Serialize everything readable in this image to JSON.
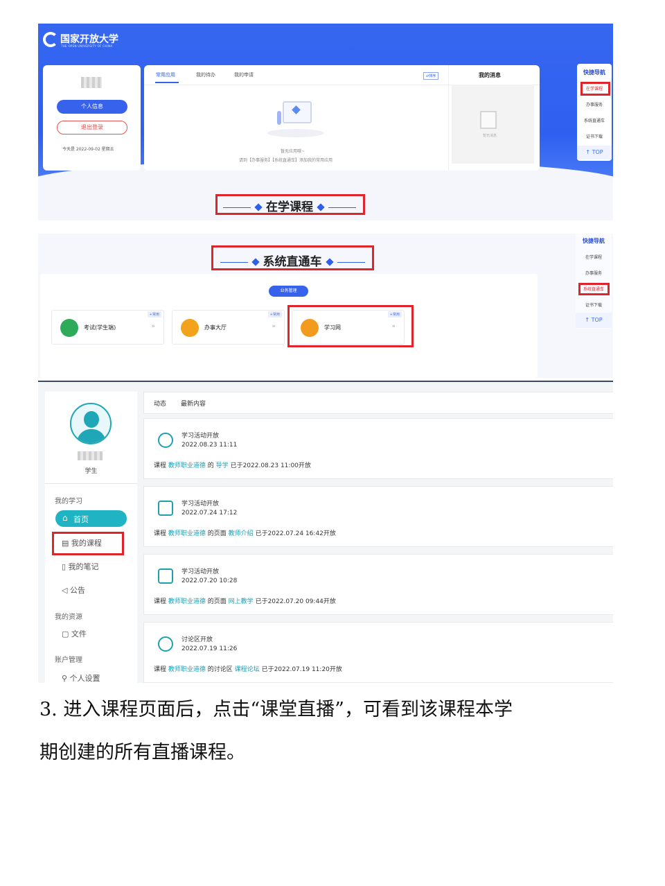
{
  "shot1": {
    "logo_name": "国家开放大学",
    "logo_sub": "THE OPEN UNIVERSITY OF CHINA",
    "user": {
      "info_button": "个人信息",
      "logout_button": "退出登录",
      "date": "今天是 2022-09-02 星期五"
    },
    "tabs": [
      "常用应用",
      "我的待办",
      "我的申请"
    ],
    "sort_button": "⇄排序",
    "empty_title": "暂无应用哦~",
    "empty_hint": "请到【办事服务】【系统直通车】添加我的常用应用",
    "messages_title": "我的消息",
    "messages_empty": "暂无消息",
    "quick_nav": {
      "title": "快捷导航",
      "items": [
        "在学课程",
        "办事服务",
        "系统直通车",
        "证书下载"
      ],
      "top": "↑ TOP"
    },
    "section_title": "在学课程"
  },
  "shot2": {
    "section_title": "系统直通车",
    "business_pill": "业务管理",
    "apps": [
      {
        "label": "考试(学生端)",
        "tag": "+常用"
      },
      {
        "label": "办事大厅",
        "tag": "+常用"
      },
      {
        "label": "学习网",
        "tag": "+常用"
      }
    ],
    "quick_nav": {
      "title": "快捷导航",
      "items": [
        "在学课程",
        "办事服务",
        "系统直通车",
        "证书下载"
      ],
      "top": "↑ TOP"
    }
  },
  "shot3": {
    "tabs": [
      "动态",
      "最新内容"
    ],
    "role": "学生",
    "sidebar": {
      "my_learning": "我的学习",
      "home": "首页",
      "my_courses": "我的课程",
      "my_notes": "我的笔记",
      "notice": "公告",
      "my_resources": "我的资源",
      "files": "文件",
      "account": "账户管理",
      "settings": "个人设置"
    },
    "feeds": [
      {
        "title": "学习活动开放",
        "date": "2022.08.23 11:11",
        "pre": "课程",
        "course": "教师职业道德",
        "mid": "的",
        "target": "导学",
        "post": "已于2022.08.23 11:00开放"
      },
      {
        "title": "学习活动开放",
        "date": "2022.07.24 17:12",
        "pre": "课程",
        "course": "教师职业道德",
        "mid": "的页面",
        "target": "教师介绍",
        "post": "已于2022.07.24 16:42开放"
      },
      {
        "title": "学习活动开放",
        "date": "2022.07.20 10:28",
        "pre": "课程",
        "course": "教师职业道德",
        "mid": "的页面",
        "target": "网上教学",
        "post": "已于2022.07.20 09:44开放"
      },
      {
        "title": "讨论区开放",
        "date": "2022.07.19 11:26",
        "pre": "课程",
        "course": "教师职业道德",
        "mid": "的讨论区",
        "target": "课程论坛",
        "post": "已于2022.07.19 11:20开放"
      }
    ]
  },
  "paragraph": {
    "line1": "3. 进入课程页面后，点击“课堂直播”，可看到该课程本学",
    "line2": "期创建的所有直播课程。"
  },
  "colors": {
    "brand_blue": "#2f5ff0",
    "highlight_red": "#e0242b",
    "teal": "#1aa0b8"
  }
}
